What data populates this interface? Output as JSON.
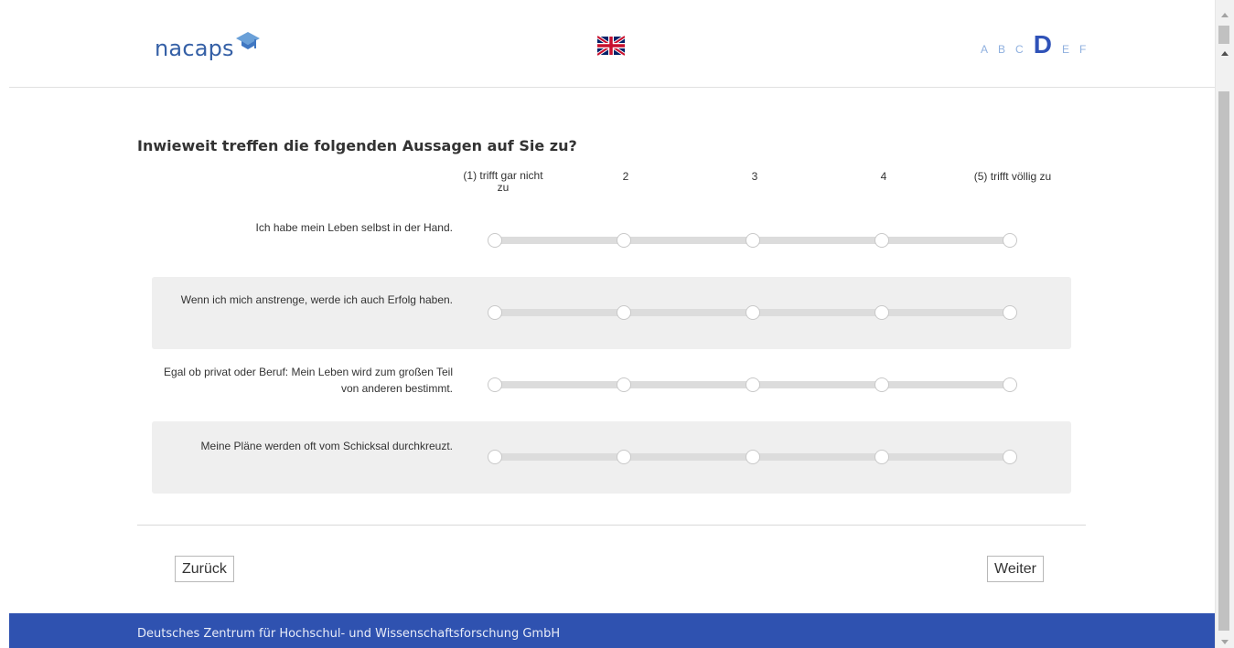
{
  "header": {
    "logo_text": "nacaps",
    "language_flag": "uk-flag-icon",
    "sections": [
      "A",
      "B",
      "C",
      "D",
      "E",
      "F"
    ],
    "active_section": "D"
  },
  "question": {
    "title": "Inwieweit treffen die folgenden Aussagen auf Sie zu?",
    "scale": [
      "(1) trifft gar nicht zu",
      "2",
      "3",
      "4",
      "(5) trifft völlig zu"
    ],
    "items": [
      {
        "label": "Ich habe mein Leben selbst in der Hand."
      },
      {
        "label": "Wenn ich mich anstrenge, werde ich auch Erfolg haben."
      },
      {
        "label": "Egal ob privat oder Beruf: Mein Leben wird zum großen Teil von anderen bestimmt."
      },
      {
        "label": "Meine Pläne werden oft vom Schicksal durchkreuzt."
      }
    ]
  },
  "nav": {
    "back_label": "Zurück",
    "next_label": "Weiter"
  },
  "footer": {
    "text": "Deutsches Zentrum für Hochschul- und Wissenschaftsforschung GmbH"
  },
  "colors": {
    "brand": "#3560a6",
    "footer_bg": "#2f52b0",
    "active_section": "#2f52b8",
    "inactive_section": "#8fb0df"
  }
}
